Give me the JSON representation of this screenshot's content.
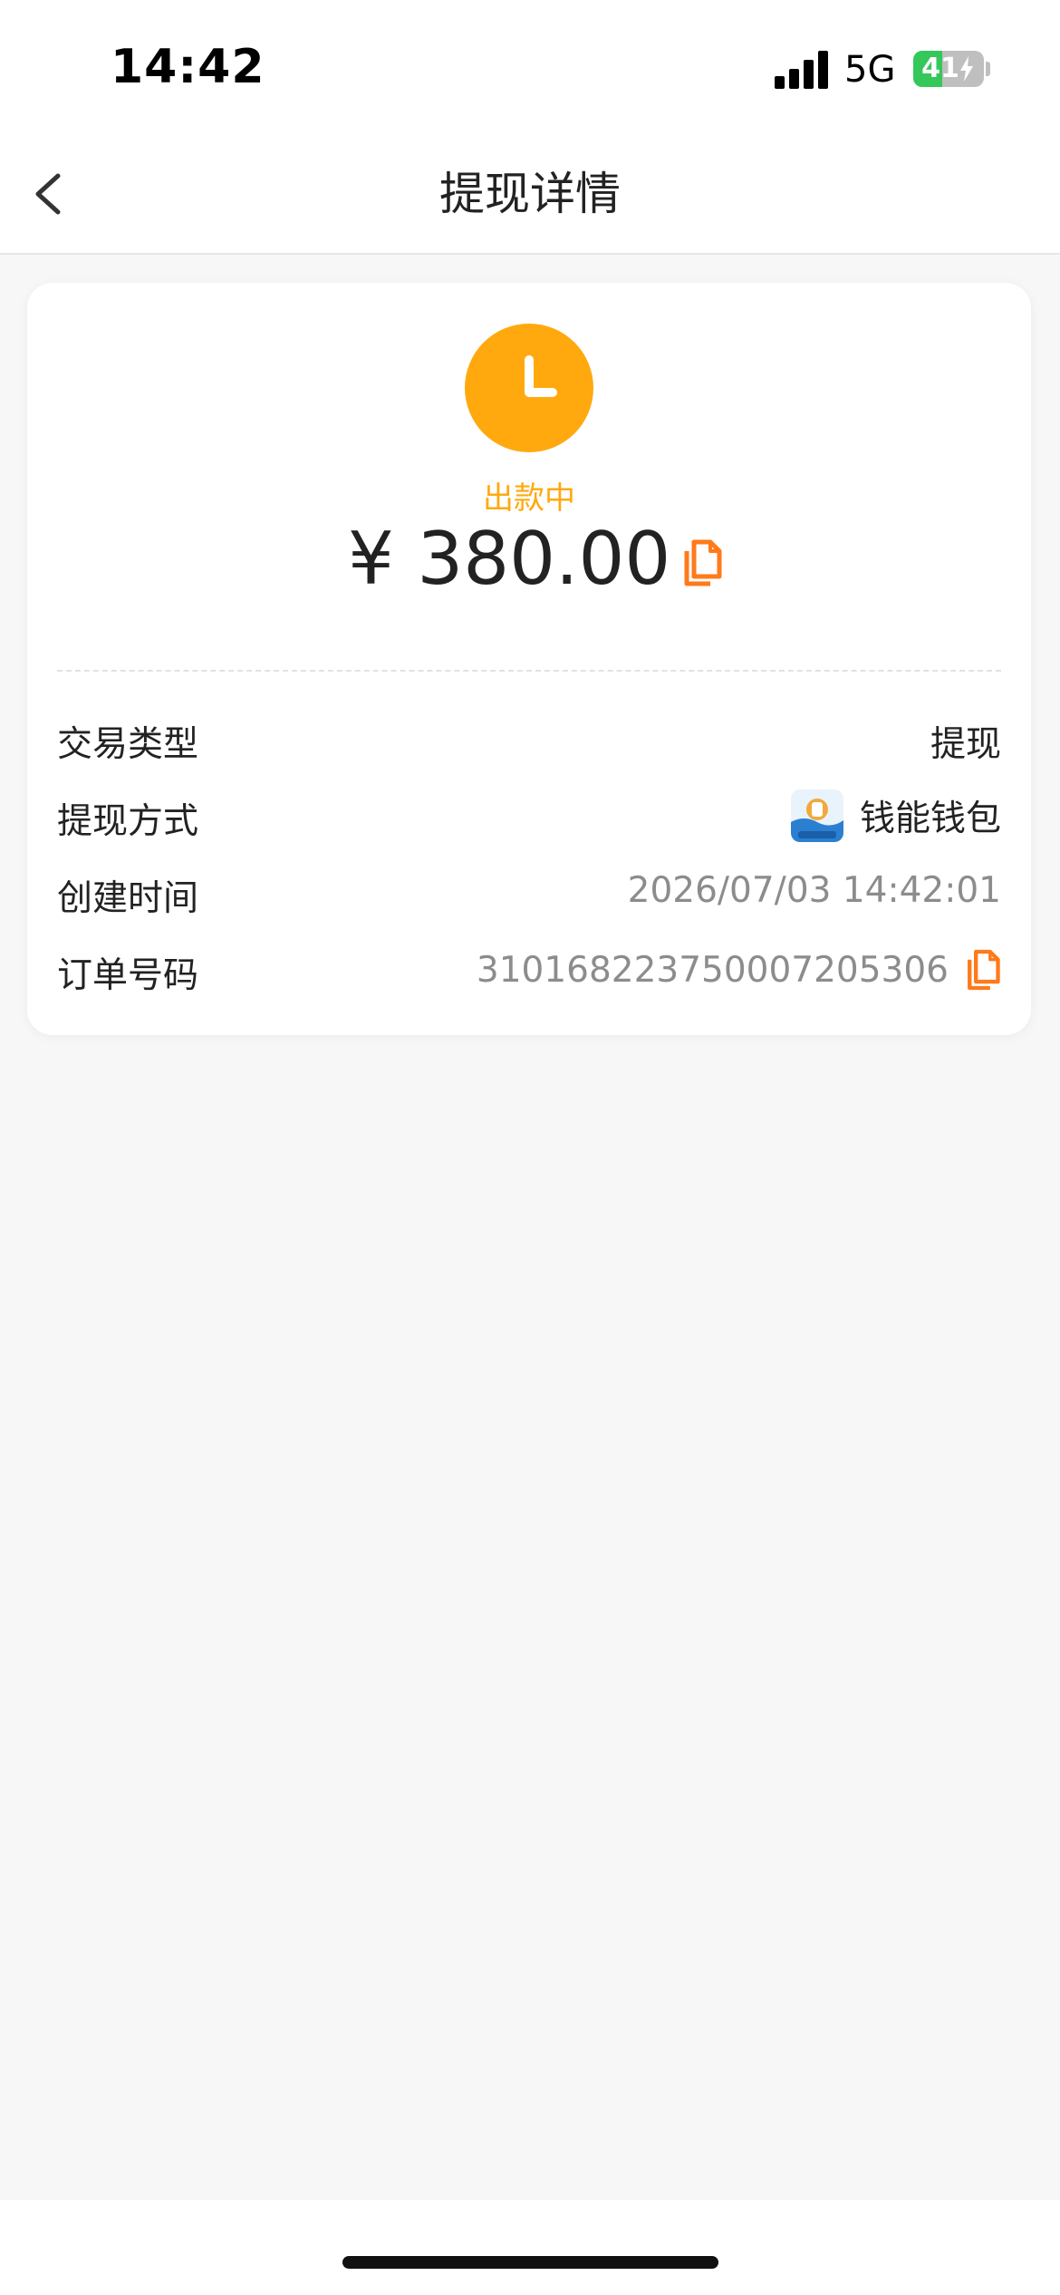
{
  "status_bar": {
    "time": "14:42",
    "network": "5G",
    "battery": "41",
    "battery_level_percent": 41
  },
  "nav": {
    "title": "提现详情"
  },
  "summary": {
    "status": "出款中",
    "amount": "¥ 380.00",
    "status_color": "#ffa90f"
  },
  "details": {
    "type_label": "交易类型",
    "type_value": "提现",
    "method_label": "提现方式",
    "method_value": "钱能钱包",
    "time_label": "创建时间",
    "time_value": "2026/07/03 14:42:01",
    "order_label": "订单号码",
    "order_value": "310168223750007205306"
  },
  "colors": {
    "accent": "#ff7a1a",
    "status": "#ffa90f"
  }
}
